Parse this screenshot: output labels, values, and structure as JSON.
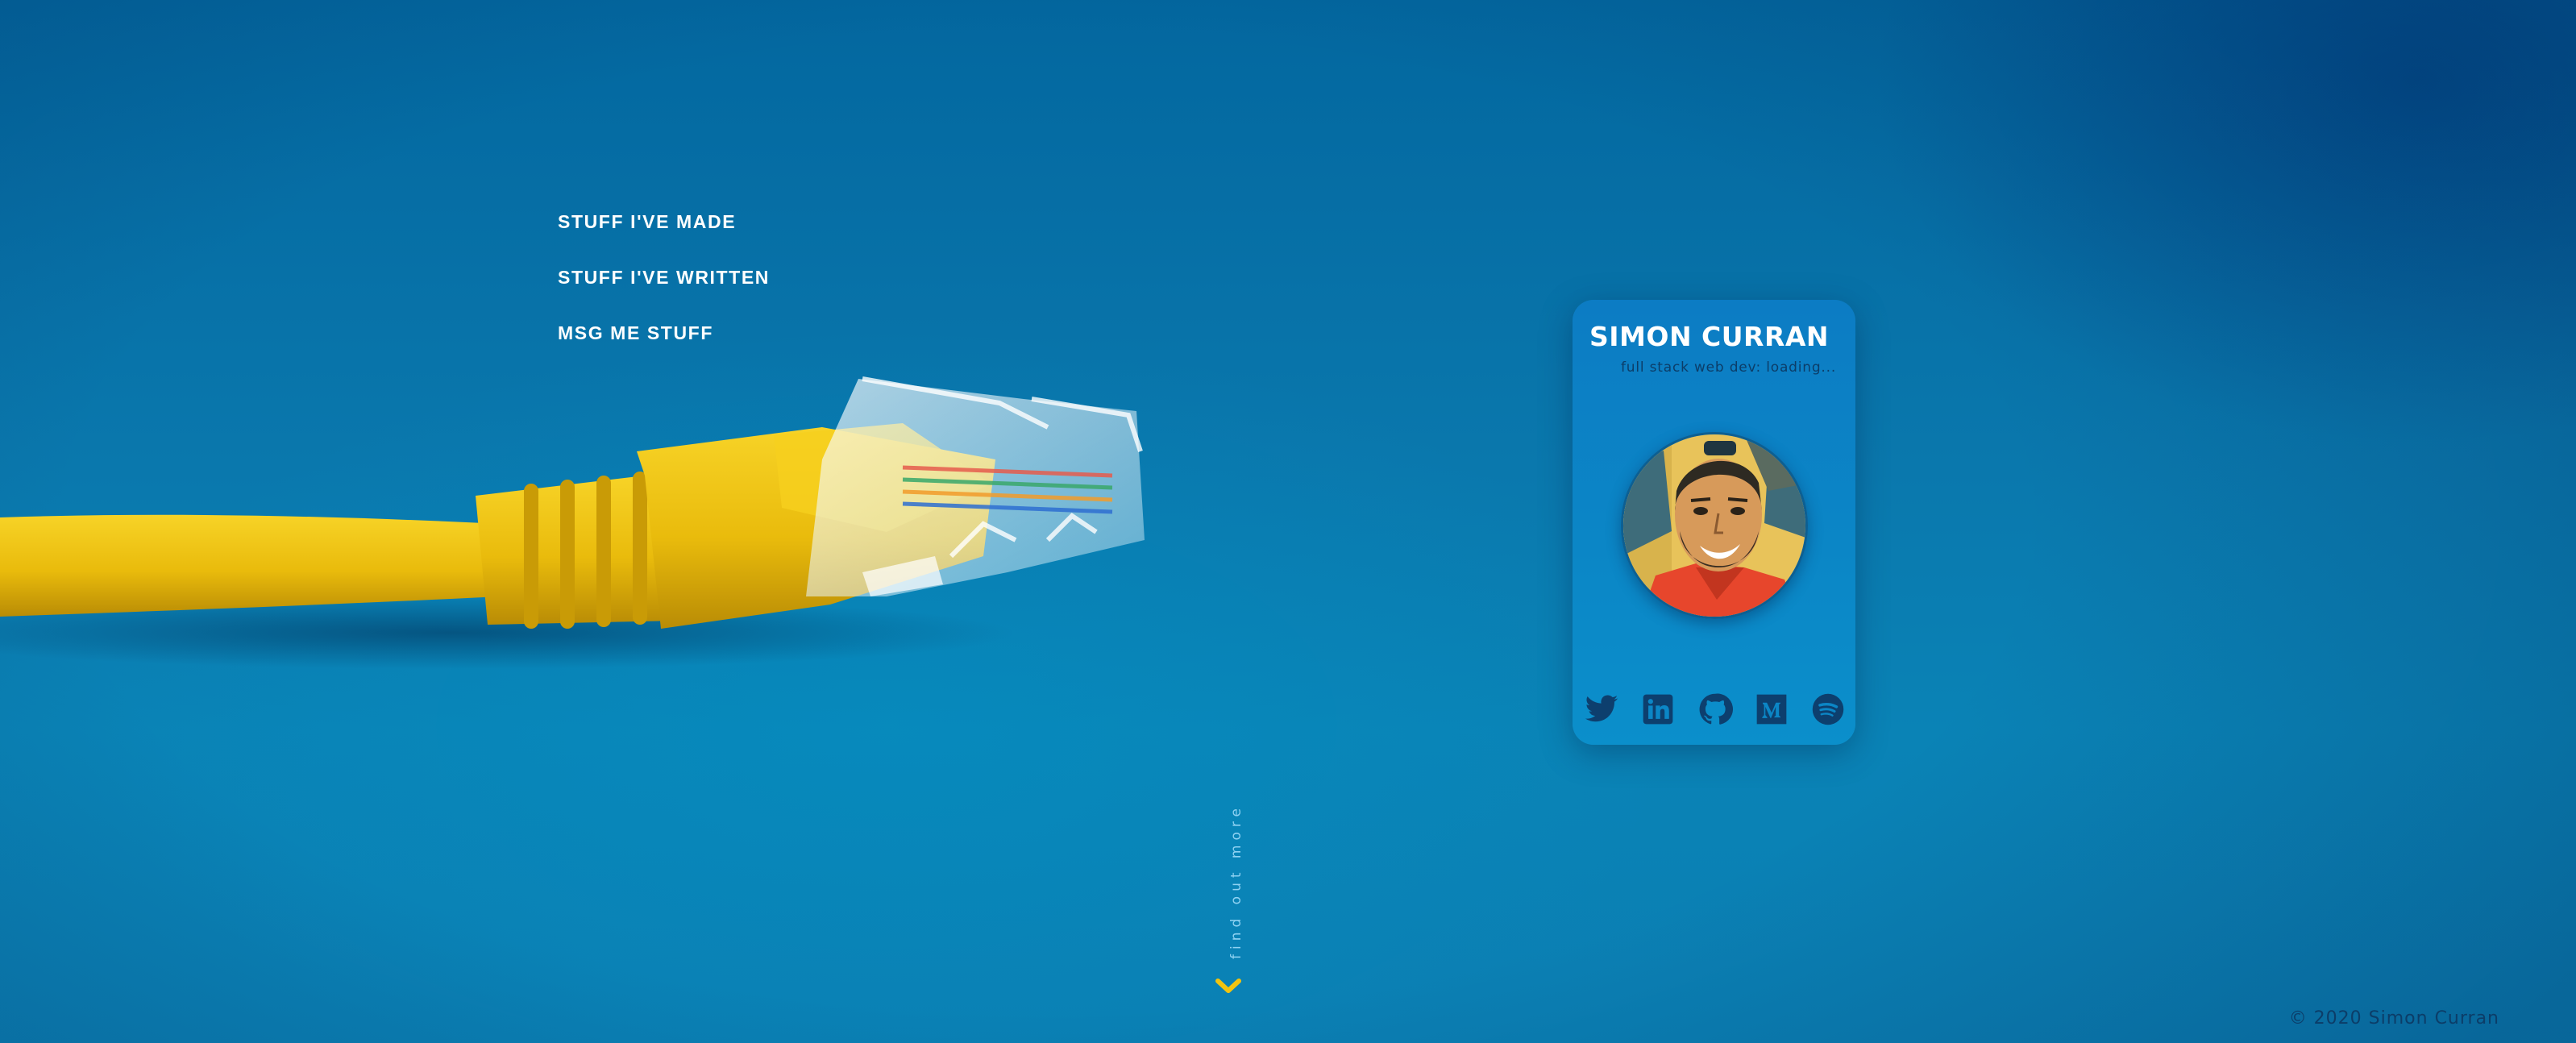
{
  "nav": {
    "items": [
      {
        "label": "STUFF I'VE MADE"
      },
      {
        "label": "STUFF I'VE WRITTEN"
      },
      {
        "label": "MSG ME STUFF"
      }
    ]
  },
  "card": {
    "name": "SIMON CURRAN",
    "tagline": "full stack web dev: loading...",
    "social_icons": [
      "twitter-icon",
      "linkedin-icon",
      "github-icon",
      "medium-icon",
      "spotify-icon"
    ]
  },
  "scroll_hint": {
    "label": "find out more",
    "icon": "chevron-down-icon"
  },
  "footer": {
    "copyright": "© 2020 Simon Curran"
  },
  "colors": {
    "background": "#0a78ad",
    "card": "#0b86c6",
    "icon": "#0d3f6e",
    "accent": "#f2c40f",
    "nav_text": "#ffffff"
  }
}
